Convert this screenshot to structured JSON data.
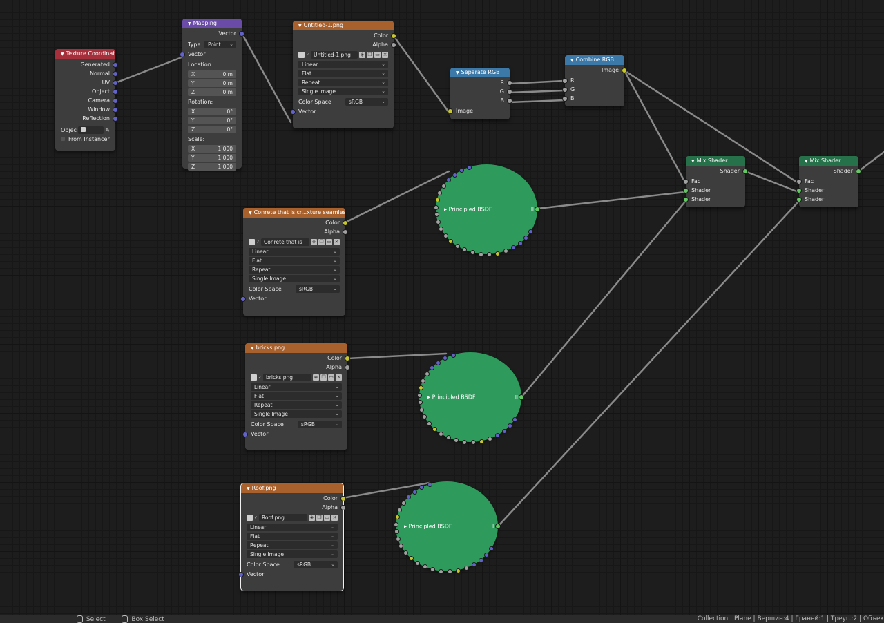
{
  "colors": {
    "background": "#1d1d1d",
    "link": "#8a8a8a",
    "socket_color": "#c7c729",
    "socket_float": "#a1a1a1",
    "socket_vector": "#6363c7",
    "socket_shader": "#63c763"
  },
  "tex_coord": {
    "title": "Texture Coordinate",
    "outputs": [
      "Generated",
      "Normal",
      "UV",
      "Object",
      "Camera",
      "Window",
      "Reflection"
    ],
    "object_label": "Objec",
    "from_instancer": "From Instancer"
  },
  "mapping": {
    "title": "Mapping",
    "output": "Vector",
    "type_label": "Type:",
    "type_value": "Point",
    "input": "Vector",
    "location_label": "Location:",
    "location": [
      {
        "axis": "X",
        "value": "0 m"
      },
      {
        "axis": "Y",
        "value": "0 m"
      },
      {
        "axis": "Z",
        "value": "0 m"
      }
    ],
    "rotation_label": "Rotation:",
    "rotation": [
      {
        "axis": "X",
        "value": "0°"
      },
      {
        "axis": "Y",
        "value": "0°"
      },
      {
        "axis": "Z",
        "value": "0°"
      }
    ],
    "scale_label": "Scale:",
    "scale": [
      {
        "axis": "X",
        "value": "1.000"
      },
      {
        "axis": "Y",
        "value": "1.000"
      },
      {
        "axis": "Z",
        "value": "1.000"
      }
    ]
  },
  "image_textures": [
    {
      "title": "Untitled-1.png",
      "image": "Untitled-1.png",
      "color": "Color",
      "alpha": "Alpha",
      "interp": "Linear",
      "proj": "Flat",
      "ext": "Repeat",
      "source": "Single Image",
      "cs_label": "Color Space",
      "cs_value": "sRGB",
      "vector": "Vector"
    },
    {
      "title": "Conrete that is cr...xture seamless.jp",
      "image": "Conrete that is ...",
      "color": "Color",
      "alpha": "Alpha",
      "interp": "Linear",
      "proj": "Flat",
      "ext": "Repeat",
      "source": "Single Image",
      "cs_label": "Color Space",
      "cs_value": "sRGB",
      "vector": "Vector"
    },
    {
      "title": "bricks.png",
      "image": "bricks.png",
      "color": "Color",
      "alpha": "Alpha",
      "interp": "Linear",
      "proj": "Flat",
      "ext": "Repeat",
      "source": "Single Image",
      "cs_label": "Color Space",
      "cs_value": "sRGB",
      "vector": "Vector"
    },
    {
      "title": "Roof.png",
      "image": "Roof.png",
      "color": "Color",
      "alpha": "Alpha",
      "interp": "Linear",
      "proj": "Flat",
      "ext": "Repeat",
      "source": "Single Image",
      "cs_label": "Color Space",
      "cs_value": "sRGB",
      "vector": "Vector"
    }
  ],
  "separate_rgb": {
    "title": "Separate RGB",
    "outputs": [
      "R",
      "G",
      "B"
    ],
    "input": "Image"
  },
  "combine_rgb": {
    "title": "Combine RGB",
    "output": "Image",
    "inputs": [
      "R",
      "G",
      "B"
    ]
  },
  "mix_shaders": [
    {
      "title": "Mix Shader",
      "output": "Shader",
      "fac": "Fac",
      "shader1": "Shader",
      "shader2": "Shader"
    },
    {
      "title": "Mix Shader",
      "output": "Shader",
      "fac": "Fac",
      "shader1": "Shader",
      "shader2": "Shader"
    }
  ],
  "bsdf": [
    {
      "label": "Principled BSDF"
    },
    {
      "label": "Principled BSDF"
    },
    {
      "label": "Principled BSDF"
    }
  ],
  "status": {
    "select": "Select",
    "box_select": "Box Select",
    "stats": "Collection | Plane | Вершин:4 | Граней:1 | Треуг.:2 | Объек"
  }
}
